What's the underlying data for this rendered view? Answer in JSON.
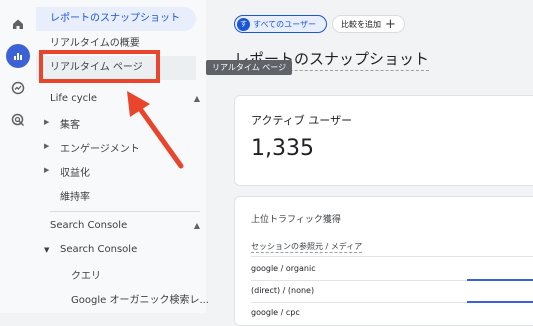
{
  "sidebar": {
    "items": [
      {
        "label": "レポートのスナップショット"
      },
      {
        "label": "リアルタイムの概要"
      },
      {
        "label": "リアルタイム ページ"
      }
    ],
    "lifecycle": {
      "title": "Life cycle",
      "items": [
        {
          "label": "集客"
        },
        {
          "label": "エンゲージメント"
        },
        {
          "label": "収益化"
        },
        {
          "label": "維持率"
        }
      ]
    },
    "search_console_section": {
      "title": "Search Console",
      "group": "Search Console",
      "items": [
        {
          "label": "クエリ"
        },
        {
          "label": "Google オーガニック検索レ..."
        }
      ]
    }
  },
  "tooltip": "リアルタイム ページ",
  "main": {
    "filter_chip": {
      "avatar": "す",
      "label": "すべてのユーザー"
    },
    "compare_chip": {
      "label": "比較を追加",
      "icon": "plus-icon"
    },
    "title": "レポートのスナップショット",
    "active_users": {
      "label": "アクティブ ユーザー",
      "value": "1,335"
    },
    "traffic": {
      "title": "上位トラフィック獲得",
      "column": "セッションの参照元 / メディア",
      "rows": [
        {
          "label": "google / organic"
        },
        {
          "label": "(direct) / (none)"
        },
        {
          "label": "google / cpc"
        }
      ]
    }
  },
  "colors": {
    "accent": "#1a56d6",
    "annotation": "#e8452c"
  }
}
